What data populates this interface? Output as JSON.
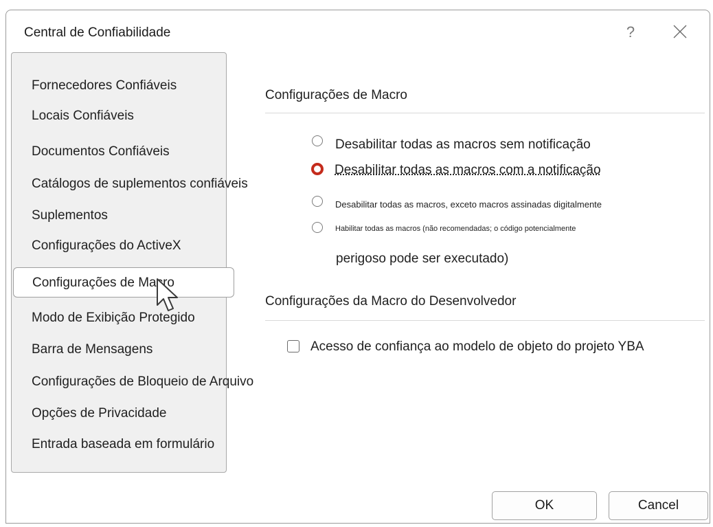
{
  "window": {
    "title": "Central de Confiabilidade",
    "help_glyph": "?",
    "close_icon": "close-icon"
  },
  "sidebar": {
    "items": [
      {
        "label": "Fornecedores Confiáveis",
        "selected": false
      },
      {
        "label": "Locais Confiáveis",
        "selected": false
      },
      {
        "label": "Documentos Confiáveis",
        "selected": false
      },
      {
        "label": "Catálogos de suplementos confiáveis",
        "selected": false
      },
      {
        "label": "Suplementos",
        "selected": false
      },
      {
        "label": "Configurações do ActiveX",
        "selected": false
      },
      {
        "label": "Configurações de Macro",
        "selected": true
      },
      {
        "label": "Modo de Exibição Protegido",
        "selected": false
      },
      {
        "label": "Barra de Mensagens",
        "selected": false
      },
      {
        "label": "Configurações de Bloqueio de Arquivo",
        "selected": false
      },
      {
        "label": "Opções de Privacidade",
        "selected": false
      },
      {
        "label": "Entrada baseada em formulário",
        "selected": false
      }
    ]
  },
  "macro_settings": {
    "heading": "Configurações de Macro",
    "options": [
      {
        "label": "Desabilitar todas as macros sem notificação",
        "checked": false
      },
      {
        "label": "Desabilitar todas as macros com a notificação",
        "checked": true
      },
      {
        "label": "Desabilitar todas as macros, exceto macros assinadas digitalmente",
        "checked": false
      },
      {
        "label": "Habilitar todas as macros (não recomendadas; o código potencialmente",
        "continuation": "perigoso pode ser executado)",
        "checked": false
      }
    ]
  },
  "developer_settings": {
    "heading": "Configurações da Macro do Desenvolvedor",
    "checkbox_label": "Acesso de confiança ao modelo de objeto do projeto YBA",
    "checked": false
  },
  "footer": {
    "ok_label": "OK",
    "cancel_label": "Cancel"
  },
  "colors": {
    "radio_selected": "#c42b1c",
    "sidebar_bg": "#f0f0f0"
  }
}
